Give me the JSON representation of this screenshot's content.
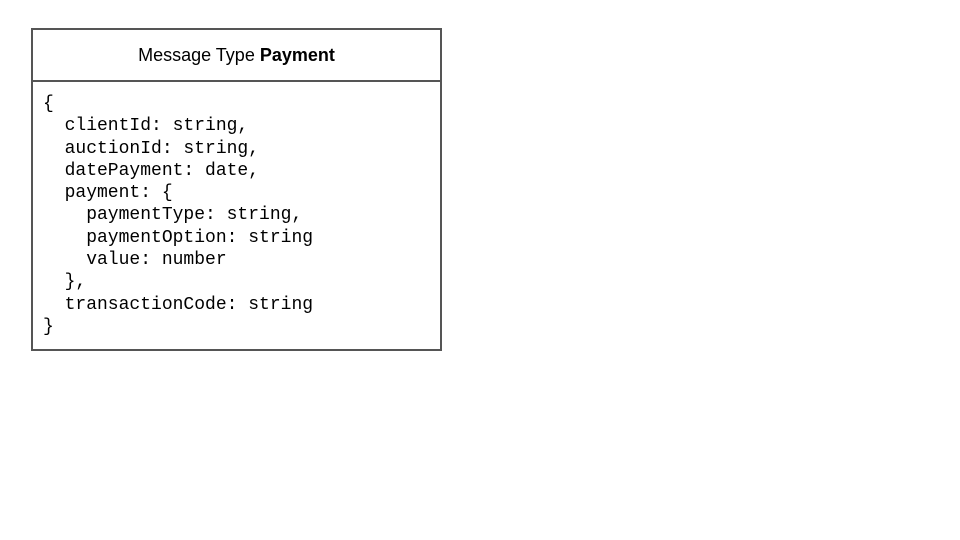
{
  "message": {
    "title_prefix": "Message Type ",
    "title_name": "Payment",
    "code_lines": [
      "{",
      "  clientId: string,",
      "  auctionId: string,",
      "  datePayment: date,",
      "  payment: {",
      "    paymentType: string,",
      "    paymentOption: string",
      "    value: number",
      "  },",
      "  transactionCode: string",
      "}"
    ]
  }
}
